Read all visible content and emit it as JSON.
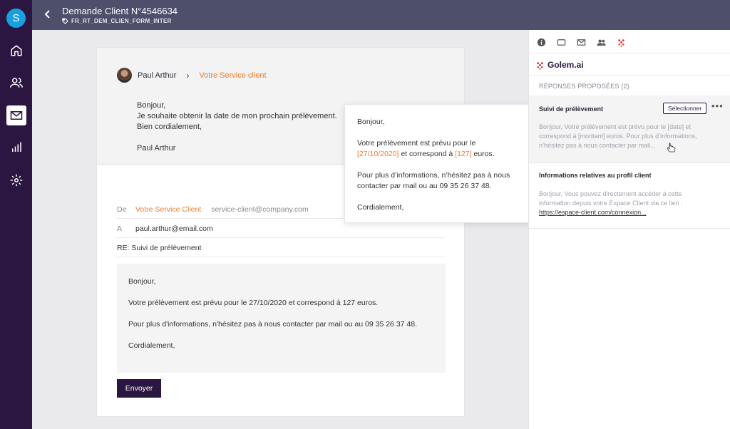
{
  "app": {
    "avatar_letter": "S",
    "colors": {
      "rail": "#2a1640",
      "header": "#4d4f6b",
      "accent": "#f07a2b",
      "avatar": "#1aa0e0"
    }
  },
  "nav": [
    {
      "icon": "home-icon",
      "active": false
    },
    {
      "icon": "users-icon",
      "active": false
    },
    {
      "icon": "mail-icon",
      "active": true
    },
    {
      "icon": "chart-icon",
      "active": false
    },
    {
      "icon": "gear-icon",
      "active": false
    }
  ],
  "header": {
    "title": "Demande Client N°4546634",
    "tag": "FR_RT_DEM_CLIEN_FORM_INTER"
  },
  "message": {
    "author": "Paul Arthur",
    "recipient": "Votre Service client",
    "lines": [
      "Bonjour,",
      "Je souhaite obtenir la date de mon prochain prélèvement.",
      "Bien cordialement,",
      "",
      "Paul Arthur"
    ]
  },
  "reply": {
    "from_label": "De",
    "from_name": "Votre Service Client",
    "from_email": "service-client@company.com",
    "to_label": "A",
    "to_email": "paul.arthur@email.com",
    "subject": "RE: Suivi de prélèvement",
    "body_greeting": "Bonjour,",
    "body_line1": "Votre prélèvement est prévu pour le 27/10/2020 et correspond à 127 euros.",
    "body_line2": "Pour plus d'informations, n'hésitez pas à nous contacter par mail ou au 09 35 26 37 48.",
    "body_closing": "Cordialement,",
    "send_label": "Envoyer"
  },
  "popover": {
    "greeting": "Bonjour,",
    "line1_a": "Votre prélèvement est prévu pour le",
    "date": "[27/10/2020]",
    "line1_b": "et correspond à",
    "amount": "[127]",
    "line1_c": "euros.",
    "line2": "Pour plus d’informations, n’hésitez pas à nous contacter par mail ou au 09 35 26 37 48.",
    "closing": "Cordialement,"
  },
  "panel": {
    "tabs": [
      "info-icon",
      "chat-icon",
      "mail-icon",
      "contacts-icon",
      "golem-icon"
    ],
    "brand": "Golem.ai",
    "section_title": "RÉPONSES PROPOSÉES (2)",
    "suggestions": [
      {
        "title": "Suivi de prélèvement",
        "select_label": "Sélectionner",
        "more": "•••",
        "text": "Bonjour, Votre prélèvement est prévu pour le [date] et correspond à [montant] euros. Pour plus d’informations, n’hésitez pas à nous contacter par mail..."
      },
      {
        "title": "Informations relatives au profil client",
        "text": "Bonjour, Vous pouvez directement accéder à cette information depuis votre Espace Client via ce lien :",
        "link": "https://espace-client.com/connexion..."
      }
    ]
  }
}
